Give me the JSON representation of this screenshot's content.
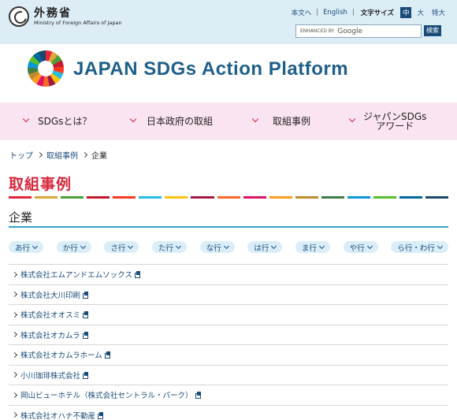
{
  "header": {
    "ministry_jp": "外務省",
    "ministry_en": "Ministry of Foreign Affairs of Japan",
    "utility_links": [
      "本文へ",
      "English"
    ],
    "font_size_label": "文字サイズ",
    "font_sizes": [
      "中",
      "大",
      "特大"
    ],
    "font_size_active": "中",
    "search_enhanced": "ENHANCED BY",
    "search_brand": "Google",
    "search_button": "検索"
  },
  "banner": {
    "title": "JAPAN SDGs Action Platform"
  },
  "nav": {
    "items": [
      {
        "label": "SDGsとは？"
      },
      {
        "label": "日本政府の取組"
      },
      {
        "label": "取組事例"
      },
      {
        "label": "ジャパンSDGs\nアワード"
      }
    ]
  },
  "breadcrumb": [
    "トップ",
    "取組事例",
    "企業"
  ],
  "page_title": "取組事例",
  "stripe_colors": [
    "#e5243b",
    "#dda63a",
    "#4c9f38",
    "#c5192d",
    "#ff3a21",
    "#26bde2",
    "#fcc30b",
    "#a21942",
    "#fd6925",
    "#dd1367",
    "#fd9d24",
    "#bf8b2e",
    "#3f7e44",
    "#0a97d9",
    "#56c02b",
    "#00689d",
    "#19486a"
  ],
  "section_title": "企業",
  "kana_filters": [
    "あ行",
    "か行",
    "さ行",
    "た行",
    "な行",
    "は行",
    "ま行",
    "や行",
    "ら行・わ行"
  ],
  "companies": [
    "株式会社エムアンドエムソックス",
    "株式会社大川印刷",
    "株式会社オオスミ",
    "株式会社オカムラ",
    "株式会社オカムラホーム",
    "小川珈琲株式会社",
    "岡山ビューホテル（株式会社セントラル・パーク）",
    "株式会社オハナ不動産"
  ]
}
